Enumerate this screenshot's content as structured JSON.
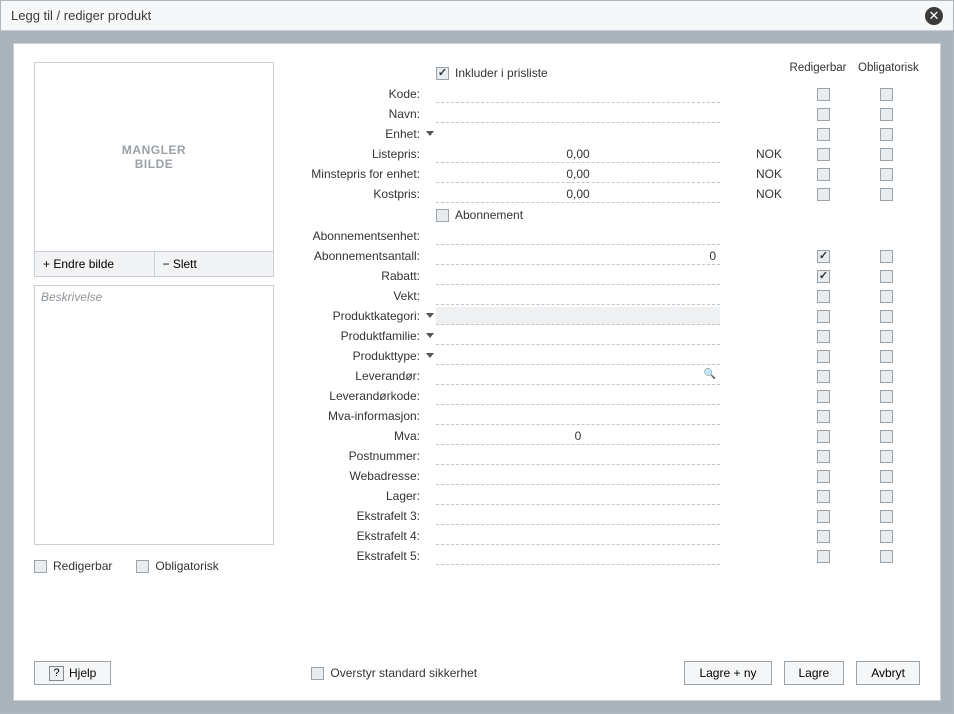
{
  "dialog": {
    "title": "Legg til / rediger produkt"
  },
  "image": {
    "placeholder": "MANGLER\nBILDE",
    "change_label": "+  Endre bilde",
    "delete_label": "−  Slett"
  },
  "description": {
    "placeholder": "Beskrivelse"
  },
  "left_flags": {
    "editable_label": "Redigerbar",
    "mandatory_label": "Obligatorisk"
  },
  "columns": {
    "editable": "Redigerbar",
    "mandatory": "Obligatorisk"
  },
  "sections": {
    "include_pricelist": {
      "label": "Inkluder i prisliste",
      "checked": true
    },
    "subscription": {
      "label": "Abonnement",
      "checked": false
    }
  },
  "currency": "NOK",
  "fields": {
    "kode": {
      "label": "Kode:",
      "value": "",
      "editable": false,
      "mandatory": false
    },
    "navn": {
      "label": "Navn:",
      "value": "",
      "editable": false,
      "mandatory": false
    },
    "enhet": {
      "label": "Enhet:",
      "value": "",
      "editable": false,
      "mandatory": false,
      "dropdown": true,
      "no_field": true
    },
    "listepris": {
      "label": "Listepris:",
      "value": "0,00",
      "editable": false,
      "mandatory": false,
      "currency": true
    },
    "minstepris": {
      "label": "Minstepris for enhet:",
      "value": "0,00",
      "editable": false,
      "mandatory": false,
      "currency": true
    },
    "kostpris": {
      "label": "Kostpris:",
      "value": "0,00",
      "editable": false,
      "mandatory": false,
      "currency": true
    },
    "abon_enhet": {
      "label": "Abonnementsenhet:",
      "value": "",
      "no_checks": true
    },
    "abon_antall": {
      "label": "Abonnementsantall:",
      "value": "0",
      "editable": true,
      "mandatory": false,
      "num_right": true
    },
    "rabatt": {
      "label": "Rabatt:",
      "value": "",
      "editable": true,
      "mandatory": false
    },
    "vekt": {
      "label": "Vekt:",
      "value": "",
      "editable": false,
      "mandatory": false
    },
    "kategori": {
      "label": "Produktkategori:",
      "value": "",
      "editable": false,
      "mandatory": false,
      "dropdown": true,
      "highlight": true
    },
    "familie": {
      "label": "Produktfamilie:",
      "value": "",
      "editable": false,
      "mandatory": false,
      "dropdown": true
    },
    "ptype": {
      "label": "Produkttype:",
      "value": "",
      "editable": false,
      "mandatory": false,
      "dropdown": true
    },
    "leverandor": {
      "label": "Leverandør:",
      "value": "",
      "editable": false,
      "mandatory": false,
      "search": true
    },
    "leverandorkode": {
      "label": "Leverandørkode:",
      "value": "",
      "editable": false,
      "mandatory": false
    },
    "mva_info": {
      "label": "Mva-informasjon:",
      "value": "",
      "editable": false,
      "mandatory": false
    },
    "mva": {
      "label": "Mva:",
      "value": "0",
      "editable": false,
      "mandatory": false,
      "num_center": true
    },
    "postnummer": {
      "label": "Postnummer:",
      "value": "",
      "editable": false,
      "mandatory": false
    },
    "webadresse": {
      "label": "Webadresse:",
      "value": "",
      "editable": false,
      "mandatory": false
    },
    "lager": {
      "label": "Lager:",
      "value": "",
      "editable": false,
      "mandatory": false
    },
    "ekstra3": {
      "label": "Ekstrafelt 3:",
      "value": "",
      "editable": false,
      "mandatory": false
    },
    "ekstra4": {
      "label": "Ekstrafelt 4:",
      "value": "",
      "editable": false,
      "mandatory": false
    },
    "ekstra5": {
      "label": "Ekstrafelt 5:",
      "value": "",
      "editable": false,
      "mandatory": false
    }
  },
  "footer": {
    "help": "Hjelp",
    "override": "Overstyr standard sikkerhet",
    "save_new": "Lagre + ny",
    "save": "Lagre",
    "cancel": "Avbryt"
  }
}
